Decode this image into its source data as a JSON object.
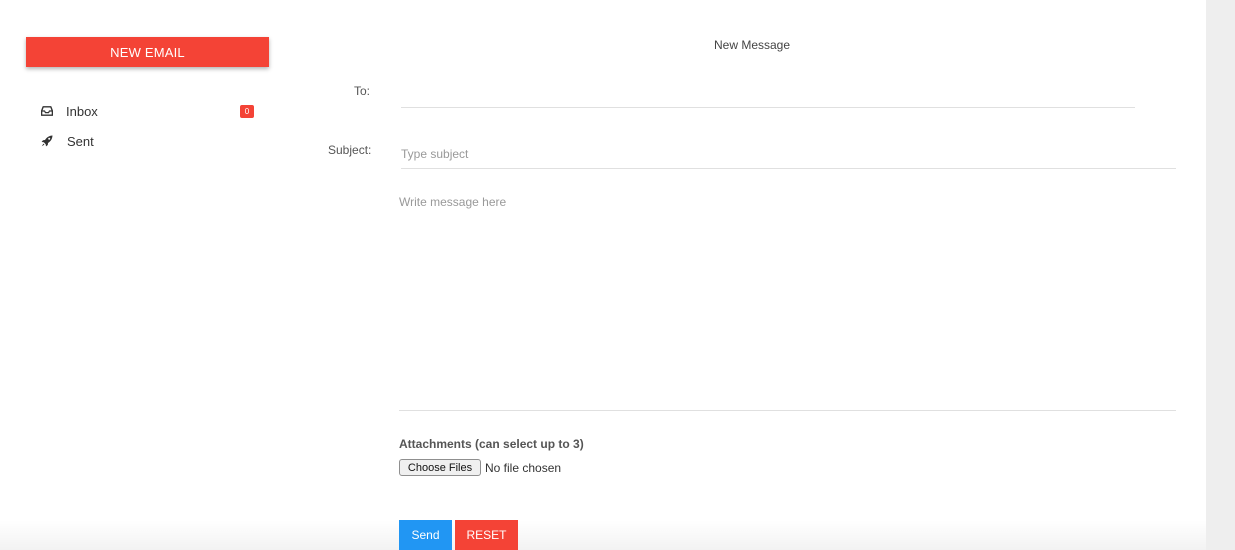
{
  "sidebar": {
    "new_email_label": "NEW EMAIL",
    "items": [
      {
        "label": "Inbox",
        "icon": "inbox-icon",
        "badge": "0"
      },
      {
        "label": "Sent",
        "icon": "rocket-icon"
      }
    ]
  },
  "compose": {
    "title": "New Message",
    "to_label": "To:",
    "to_value": "",
    "subject_label": "Subject:",
    "subject_placeholder": "Type subject",
    "message_placeholder": "Write message here",
    "attachments_label": "Attachments (can select up to 3)",
    "choose_files_label": "Choose Files",
    "file_status": "No file chosen",
    "send_label": "Send",
    "reset_label": "RESET"
  },
  "colors": {
    "accent_red": "#f44336",
    "accent_blue": "#2196f3"
  }
}
